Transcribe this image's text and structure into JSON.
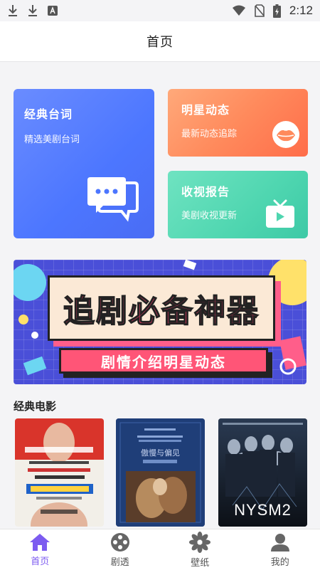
{
  "status_bar": {
    "time": "2:12"
  },
  "header": {
    "title": "首页"
  },
  "cards": {
    "classic": {
      "title": "经典台词",
      "subtitle": "精选美剧台词"
    },
    "star": {
      "title": "明星动态",
      "subtitle": "最新动态追踪"
    },
    "report": {
      "title": "收视报告",
      "subtitle": "美剧收视更新"
    }
  },
  "banner": {
    "title": "追剧必备神器",
    "subtitle": "剧情介绍明星动态"
  },
  "section": {
    "title": "经典电影",
    "posters": [
      {
        "icon": "poster-mr-bean"
      },
      {
        "icon": "poster-pride-and-prejudice",
        "caption": "傲慢与偏见"
      },
      {
        "icon": "poster-nysm2",
        "caption": "NYSM2"
      }
    ]
  },
  "tabbar": {
    "items": [
      {
        "label": "首页",
        "active": true
      },
      {
        "label": "剧透",
        "active": false
      },
      {
        "label": "壁纸",
        "active": false
      },
      {
        "label": "我的",
        "active": false
      }
    ]
  },
  "colors": {
    "accent": "#7c5bf0",
    "classic_card": "#4c76ff",
    "star_card": "#ff8a5c",
    "report_card": "#4fd6b0",
    "banner_bg": "#4a4fd8",
    "banner_title": "#ff3d6e"
  }
}
